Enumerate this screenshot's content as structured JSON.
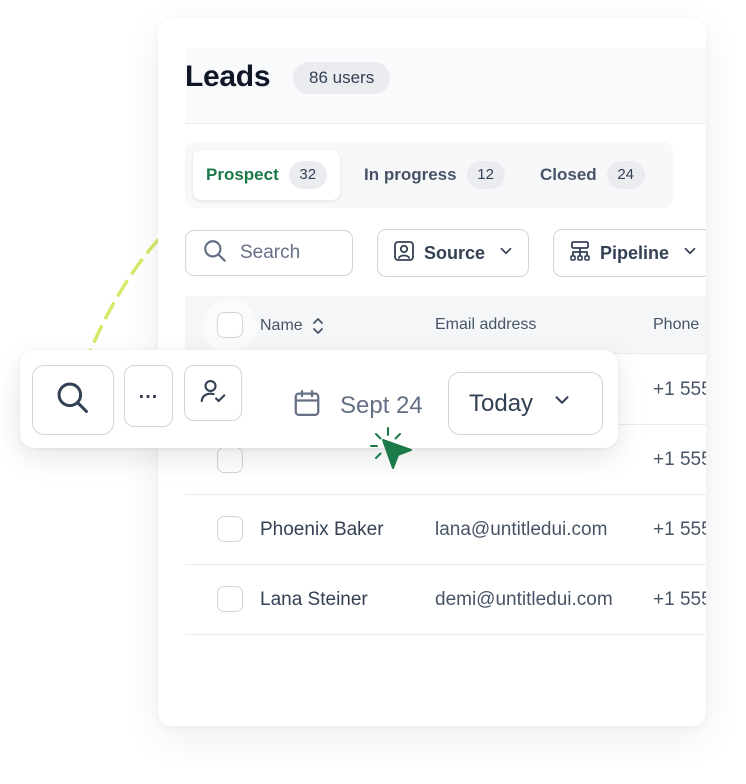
{
  "header": {
    "title": "Leads",
    "count": "86 users"
  },
  "tabs": [
    {
      "label": "Prospect",
      "count": "32",
      "active": true
    },
    {
      "label": "In progress",
      "count": "12",
      "active": false
    },
    {
      "label": "Closed",
      "count": "24",
      "active": false
    }
  ],
  "filters": {
    "search_placeholder": "Search",
    "source_label": "Source",
    "pipeline_label": "Pipeline"
  },
  "table": {
    "columns": {
      "name": "Name",
      "email": "Email address",
      "phone": "Phone"
    },
    "rows": [
      {
        "name": "Phoenix Baker",
        "email": "lana@untitledui.com",
        "phone": "+1 555"
      },
      {
        "name": "Lana Steiner",
        "email": "demi@untitledui.com",
        "phone": "+1 555"
      }
    ],
    "hidden_row_phones": [
      "+1 555",
      "+1 555"
    ]
  },
  "toolbar": {
    "more_label": "...",
    "date": "Sept 24",
    "range_label": "Today"
  },
  "colors": {
    "accent_green": "#1b7a47",
    "arc_yellow_green": "#d7e86a",
    "border": "#d0d5dd",
    "text_muted": "#667085"
  },
  "icons": [
    "search-icon",
    "user-square-icon",
    "hierarchy-icon",
    "chevron-down-icon",
    "chevron-selector-icon",
    "more-icon",
    "user-check-icon",
    "calendar-icon",
    "cursor-click-icon"
  ]
}
